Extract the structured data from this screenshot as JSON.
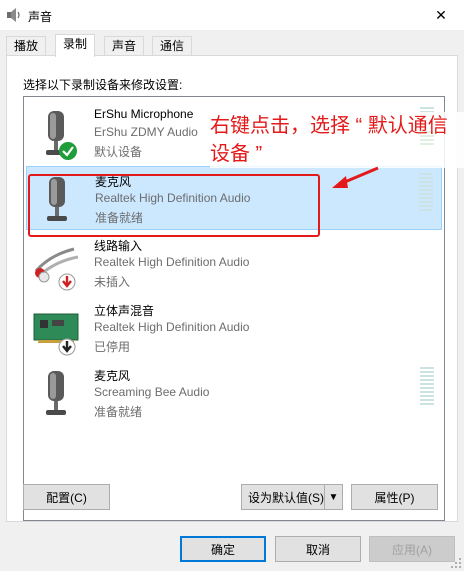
{
  "window": {
    "title": "声音",
    "close_glyph": "✕"
  },
  "tabs": [
    {
      "label": "播放",
      "active": false
    },
    {
      "label": "录制",
      "active": true
    },
    {
      "label": "声音",
      "active": false
    },
    {
      "label": "通信",
      "active": false
    }
  ],
  "panel": {
    "instruction": "选择以下录制设备来修改设置:"
  },
  "devices": [
    {
      "name": "ErShu Microphone",
      "driver": "ErShu ZDMY Audio",
      "status": "默认设备",
      "icon": "microphone-icon",
      "badge": "default-check-icon",
      "meter_level": 0.3
    },
    {
      "name": "麦克风",
      "driver": "Realtek High Definition Audio",
      "status": "准备就绪",
      "icon": "microphone-icon",
      "badge": null,
      "meter_level": 0,
      "selected": true
    },
    {
      "name": "线路输入",
      "driver": "Realtek High Definition Audio",
      "status": "未插入",
      "icon": "line-in-cable-icon",
      "badge": "unplugged-icon"
    },
    {
      "name": "立体声混音",
      "driver": "Realtek High Definition Audio",
      "status": "已停用",
      "icon": "sound-card-icon",
      "badge": "disabled-icon"
    },
    {
      "name": "麦克风",
      "driver": "Screaming Bee Audio",
      "status": "准备就绪",
      "icon": "microphone-icon",
      "badge": null,
      "meter_level": 0
    }
  ],
  "annotation": {
    "text": "右键点击，选择 “ 默认通信设备 ”",
    "color": "#e41a1a"
  },
  "buttons": {
    "configure": "配置(C)",
    "set_default": "设为默认值(S)",
    "set_default_arrow": "▼",
    "properties": "属性(P)",
    "ok": "确定",
    "cancel": "取消",
    "apply": "应用(A)"
  },
  "colors": {
    "selection_bg": "#cce8ff",
    "accent": "#0078d7",
    "annotation": "#e41a1a"
  }
}
